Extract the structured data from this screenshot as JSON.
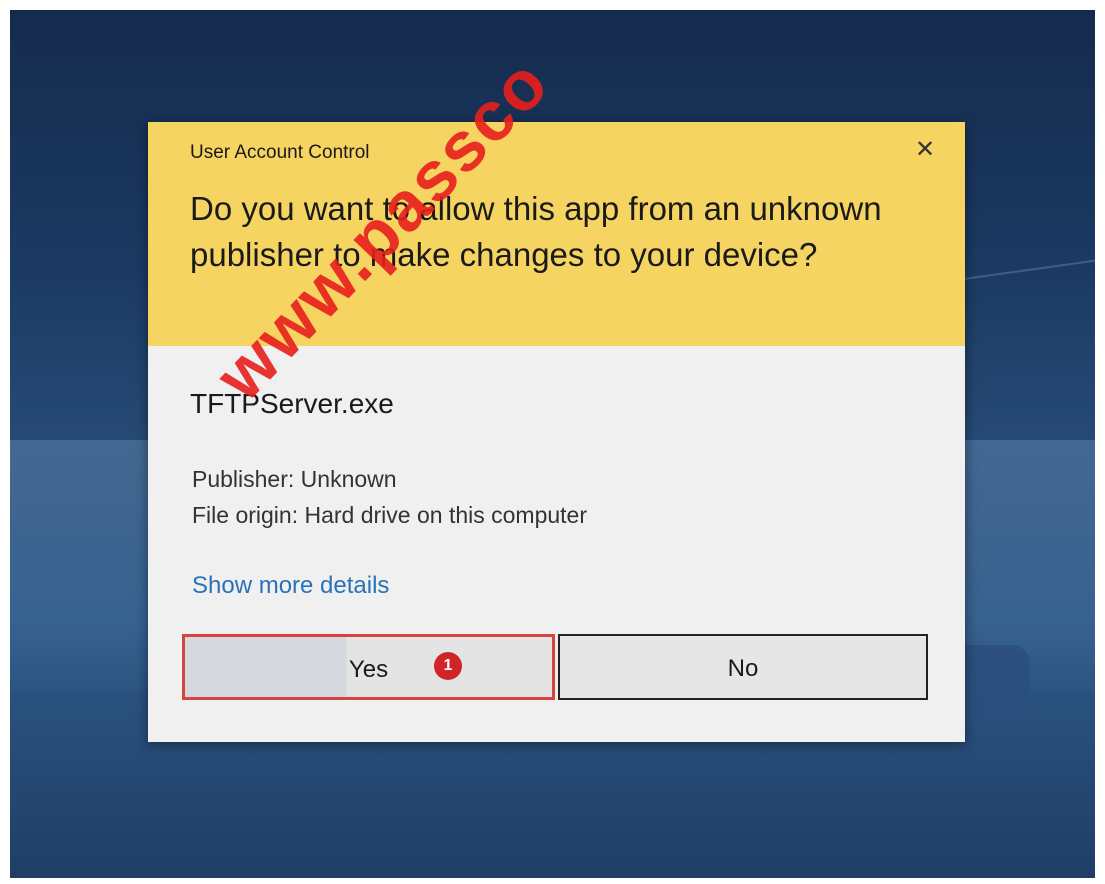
{
  "dialog": {
    "title": "User Account Control",
    "close_glyph": "✕",
    "question": "Do you want to allow this app from an unknown publisher to make changes to your device?",
    "app_name": "TFTPServer.exe",
    "publisher": "Publisher: Unknown",
    "file_origin": "File origin: Hard drive on this computer",
    "more_details_link": "Show more details",
    "yes_label": "Yes",
    "no_label": "No",
    "step_badge": "1"
  },
  "watermark": "www.passco",
  "colors": {
    "header_bg": "#f6d462",
    "body_bg": "#f0f0f0",
    "link": "#2a72b8",
    "highlight_border": "#d6443f",
    "badge": "#d0232a",
    "watermark": "#e8201d"
  },
  "icons": {
    "close": "close-icon"
  }
}
